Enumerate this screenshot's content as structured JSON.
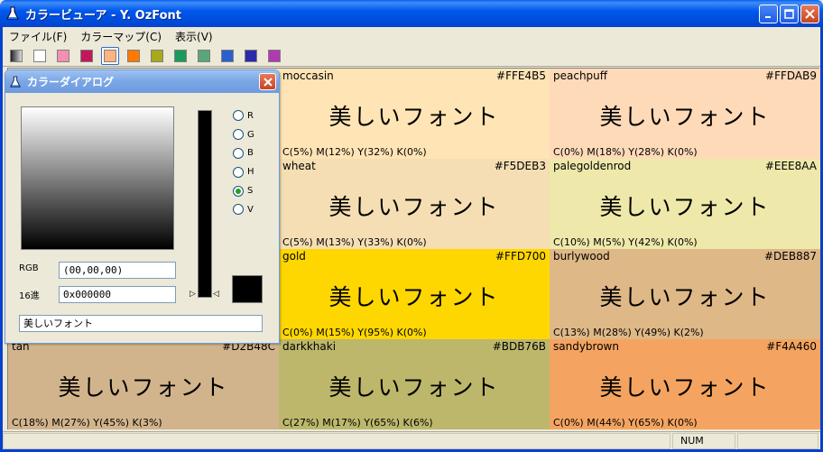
{
  "window": {
    "title": "カラービューア - Y. OzFont"
  },
  "menu": [
    {
      "label": "ファイル(F)"
    },
    {
      "label": "カラーマップ(C)"
    },
    {
      "label": "表示(V)"
    }
  ],
  "toolbar": {
    "swatches": [
      "#444444",
      "#ffffff",
      "#f48fb1",
      "#c2185b",
      "#ffb380",
      "#ff7a00",
      "#a8a81a",
      "#1a9a5a",
      "#5aa67a",
      "#2a5fcf",
      "#2a2aaa",
      "#b03ab0"
    ],
    "selected_index": 4
  },
  "grid": {
    "sample_text": "美しいフォント",
    "cells": [
      {
        "name": "",
        "hex": "",
        "cmyk": "",
        "color": "#ece9d8"
      },
      {
        "name": "moccasin",
        "hex": "#FFE4B5",
        "cmyk": "C(5%) M(12%) Y(32%) K(0%)",
        "color": "#FFE4B5"
      },
      {
        "name": "peachpuff",
        "hex": "#FFDAB9",
        "cmyk": "C(0%) M(18%) Y(28%) K(0%)",
        "color": "#FFDAB9"
      },
      {
        "name": "",
        "hex": "",
        "cmyk": "",
        "color": "#ece9d8"
      },
      {
        "name": "wheat",
        "hex": "#F5DEB3",
        "cmyk": "C(5%) M(13%) Y(33%) K(0%)",
        "color": "#F5DEB3"
      },
      {
        "name": "palegoldenrod",
        "hex": "#EEE8AA",
        "cmyk": "C(10%) M(5%) Y(42%) K(0%)",
        "color": "#EEE8AA"
      },
      {
        "name": "",
        "hex": "",
        "cmyk": "",
        "color": "#ece9d8"
      },
      {
        "name": "gold",
        "hex": "#FFD700",
        "cmyk": "C(0%) M(15%) Y(95%) K(0%)",
        "color": "#FFD700"
      },
      {
        "name": "burlywood",
        "hex": "#DEB887",
        "cmyk": "C(13%) M(28%) Y(49%) K(2%)",
        "color": "#DEB887"
      },
      {
        "name": "tan",
        "hex": "#D2B48C",
        "cmyk": "C(18%) M(27%) Y(45%) K(3%)",
        "color": "#D2B48C"
      },
      {
        "name": "darkkhaki",
        "hex": "#BDB76B",
        "cmyk": "C(27%) M(17%) Y(65%) K(6%)",
        "color": "#BDB76B"
      },
      {
        "name": "sandybrown",
        "hex": "#F4A460",
        "cmyk": "C(0%) M(44%) Y(65%) K(0%)",
        "color": "#F4A460"
      }
    ]
  },
  "dialog": {
    "title": "カラーダイアログ",
    "radios": [
      {
        "label": "R",
        "checked": false
      },
      {
        "label": "G",
        "checked": false
      },
      {
        "label": "B",
        "checked": false
      },
      {
        "label": "H",
        "checked": false
      },
      {
        "label": "S",
        "checked": true
      },
      {
        "label": "V",
        "checked": false
      }
    ],
    "rgb_label": "RGB",
    "rgb_value": "(00,00,00)",
    "hex_label": "16進",
    "hex_value": "0x000000",
    "sample_input": "美しいフォント",
    "preview_color": "#000000"
  },
  "status": {
    "num": "NUM"
  }
}
